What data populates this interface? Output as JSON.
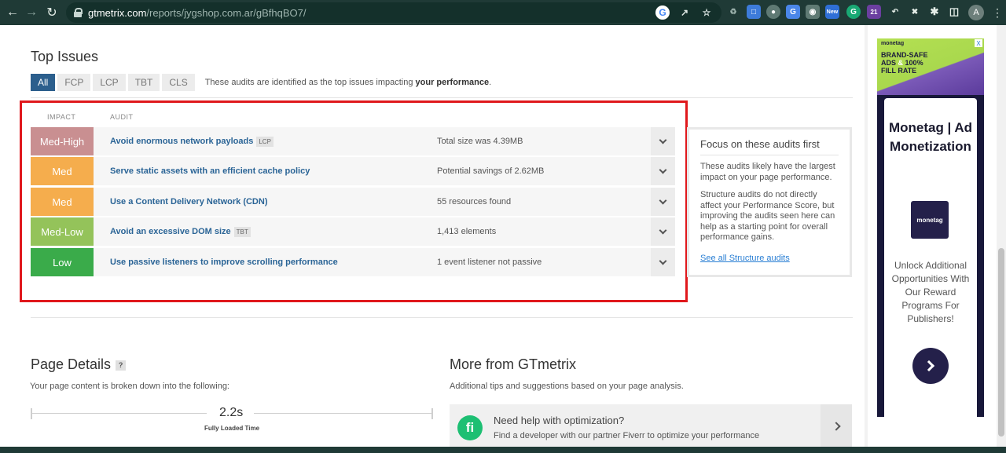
{
  "browser": {
    "url_host": "gtmetrix.com",
    "url_path": "/reports/jygshop.com.ar/gBfhqBO7/",
    "extension_new_badge": "New",
    "extension_count_badge": "21",
    "profile_initial": "A"
  },
  "top_issues": {
    "title": "Top Issues",
    "tabs": [
      "All",
      "FCP",
      "LCP",
      "TBT",
      "CLS"
    ],
    "description_prefix": "These audits are identified as the top issues impacting ",
    "description_bold": "your performance",
    "description_suffix": ".",
    "col_impact": "IMPACT",
    "col_audit": "AUDIT",
    "audits": [
      {
        "impact": "Med-High",
        "color": "#c98f91",
        "name": "Avoid enormous network payloads",
        "tag": "LCP",
        "detail": "Total size was 4.39MB"
      },
      {
        "impact": "Med",
        "color": "#f5ad4d",
        "name": "Serve static assets with an efficient cache policy",
        "tag": "",
        "detail": "Potential savings of 2.62MB"
      },
      {
        "impact": "Med",
        "color": "#f5ad4d",
        "name": "Use a Content Delivery Network (CDN)",
        "tag": "",
        "detail": "55 resources found"
      },
      {
        "impact": "Med-Low",
        "color": "#94c35a",
        "name": "Avoid an excessive DOM size",
        "tag": "TBT",
        "detail": "1,413 elements"
      },
      {
        "impact": "Low",
        "color": "#3aab4a",
        "name": "Use passive listeners to improve scrolling performance",
        "tag": "",
        "detail": "1 event listener not passive"
      }
    ]
  },
  "focus": {
    "title": "Focus on these audits first",
    "p1": "These audits likely have the largest impact on your page performance.",
    "p2": "Structure audits do not directly affect your Performance Score, but improving the audits seen here can help as a starting point for overall performance gains.",
    "link": "See all Structure audits"
  },
  "page_details": {
    "title": "Page Details",
    "help": "?",
    "subtitle": "Your page content is broken down into the following:",
    "fully_loaded_value": "2.2s",
    "fully_loaded_label": "Fully Loaded Time"
  },
  "more": {
    "title": "More from GTmetrix",
    "subtitle": "Additional tips and suggestions based on your page analysis.",
    "card_title": "Need help with optimization?",
    "card_desc": "Find a developer with our partner Fiverr to optimize your performance",
    "card_logo": "fi"
  },
  "ad": {
    "brand_small": "monetag",
    "close": "X",
    "headline_line1": "BRAND-SAFE",
    "headline_line2_a": "ADS",
    "headline_line2_amp": "&",
    "headline_line2_b": "100%",
    "headline_line3": "FILL RATE",
    "card_title": "Monetag | Ad Monetization",
    "card_logo": "monetag",
    "card_text": "Unlock Additional Opportunities With Our Reward Programs For Publishers!"
  }
}
